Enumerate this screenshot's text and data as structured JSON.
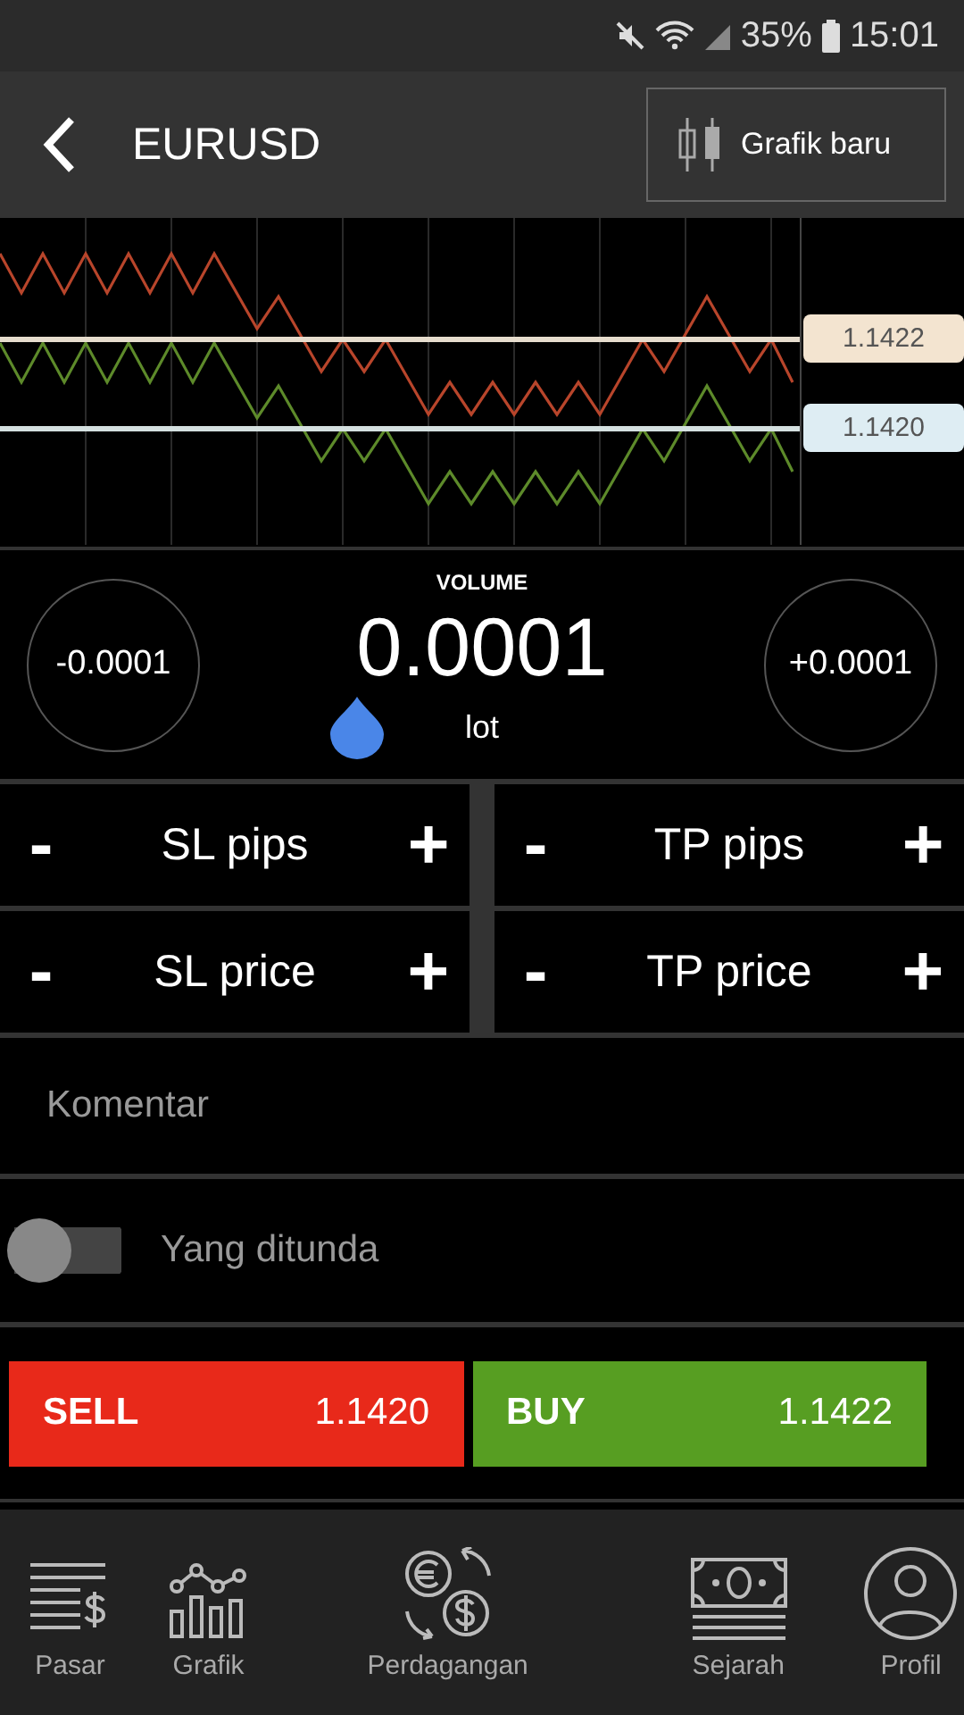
{
  "status_bar": {
    "battery": "35%",
    "time": "15:01"
  },
  "header": {
    "title": "EURUSD",
    "new_chart_button": "Grafik baru"
  },
  "chart": {
    "ask_tag": "1.1422",
    "bid_tag": "1.1420"
  },
  "volume": {
    "label": "VOLUME",
    "value": "0.0001",
    "unit": "lot",
    "decrease": "-0.0001",
    "increase": "+0.0001"
  },
  "steppers": [
    {
      "label": "SL pips",
      "minus": "-",
      "plus": "+"
    },
    {
      "label": "TP pips",
      "minus": "-",
      "plus": "+"
    },
    {
      "label": "SL price",
      "minus": "-",
      "plus": "+"
    },
    {
      "label": "TP price",
      "minus": "-",
      "plus": "+"
    }
  ],
  "comment": {
    "placeholder": "Komentar"
  },
  "pending": {
    "label": "Yang ditunda",
    "on": false
  },
  "trade_buttons": [
    {
      "kind": "sell",
      "label": "SELL",
      "price": "1.1420"
    },
    {
      "kind": "buy",
      "label": "BUY",
      "price": "1.1422"
    }
  ],
  "nav": [
    {
      "kind": "market",
      "label": "Pasar"
    },
    {
      "kind": "chart",
      "label": "Grafik"
    },
    {
      "kind": "trade",
      "label": "Perdagangan"
    },
    {
      "kind": "history",
      "label": "Sejarah"
    },
    {
      "kind": "profile",
      "label": "Profil"
    }
  ]
}
